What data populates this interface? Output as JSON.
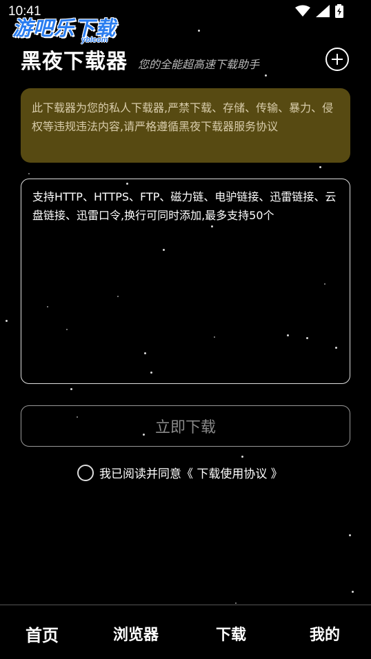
{
  "status_bar": {
    "time": "10:41"
  },
  "watermark": {
    "main": "游吧乐下载",
    "sub": "yblcom"
  },
  "header": {
    "title": "黑夜下载器",
    "subtitle": "您的全能超高速下载助手"
  },
  "notice": {
    "text": "此下载器为您的私人下载器,严禁下载、存储、传输、暴力、侵权等违规违法内容,请严格遵循黑夜下载器服务协议"
  },
  "input": {
    "placeholder": "支持HTTP、HTTPS、FTP、磁力链、电驴链接、迅雷链接、云盘链接、迅雷口令,换行可同时添加,最多支持50个"
  },
  "download_button": {
    "label": "立即下载"
  },
  "agreement": {
    "text": "我已阅读并同意《 下载使用协议 》"
  },
  "nav": {
    "items": [
      {
        "label": "首页"
      },
      {
        "label": "浏览器"
      },
      {
        "label": "下载"
      },
      {
        "label": "我的"
      }
    ]
  },
  "colors": {
    "background": "#000000",
    "notice_bg": "#574a12",
    "watermark_blue": "#2a7df0"
  }
}
